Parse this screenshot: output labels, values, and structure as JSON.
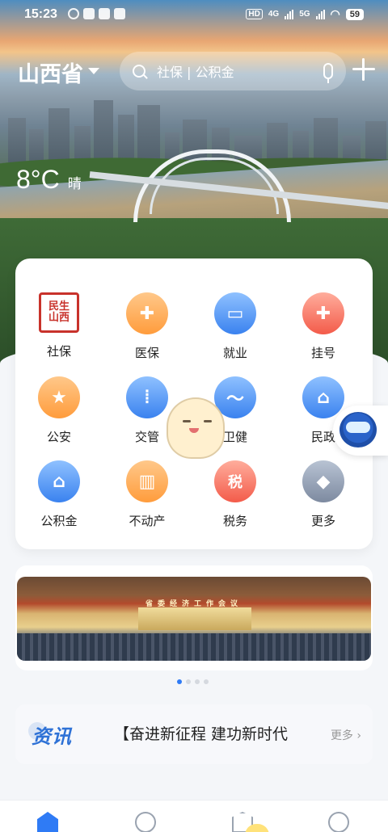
{
  "status_bar": {
    "time": "15:23",
    "hd": "HD",
    "net1": "4G",
    "net2": "5G",
    "battery": "59"
  },
  "header": {
    "region": "山西省",
    "search_placeholder": "社保 | 公积金"
  },
  "weather": {
    "temperature": "8°C",
    "condition": "晴"
  },
  "services": [
    {
      "label": "社保",
      "icon": "social-security-seal-icon",
      "seal_text": "民生山西"
    },
    {
      "label": "医保",
      "icon": "medical-insurance-icon",
      "glyph": "✚"
    },
    {
      "label": "就业",
      "icon": "employment-briefcase-icon",
      "glyph": "▭"
    },
    {
      "label": "挂号",
      "icon": "hospital-registration-icon",
      "glyph": "✚"
    },
    {
      "label": "公安",
      "icon": "police-badge-icon",
      "glyph": "★"
    },
    {
      "label": "交管",
      "icon": "traffic-light-icon",
      "glyph": "⦙"
    },
    {
      "label": "卫健",
      "icon": "health-heartbeat-icon",
      "glyph": "〜"
    },
    {
      "label": "民政",
      "icon": "civil-affairs-people-icon",
      "glyph": "⌂"
    },
    {
      "label": "公积金",
      "icon": "housing-fund-house-icon",
      "glyph": "⌂"
    },
    {
      "label": "不动产",
      "icon": "real-estate-building-icon",
      "glyph": "▥"
    },
    {
      "label": "税务",
      "icon": "tax-icon",
      "glyph": "税"
    },
    {
      "label": "更多",
      "icon": "more-apps-icon",
      "glyph": "◆"
    }
  ],
  "banner": {
    "title": "省委经济工作会议",
    "slide_count": 4,
    "active_slide": 1
  },
  "news": {
    "tag": "资讯",
    "headline": "【奋进新征程 建功新时代",
    "more": "更多"
  },
  "tabbar": [
    "home-icon",
    "favorite-heart-icon",
    "services-icon",
    "profile-icon"
  ],
  "colors": {
    "accent": "#2f7bf5",
    "orange": "#ff9c3c",
    "blue": "#3a82ef",
    "red": "#f35b4a"
  }
}
